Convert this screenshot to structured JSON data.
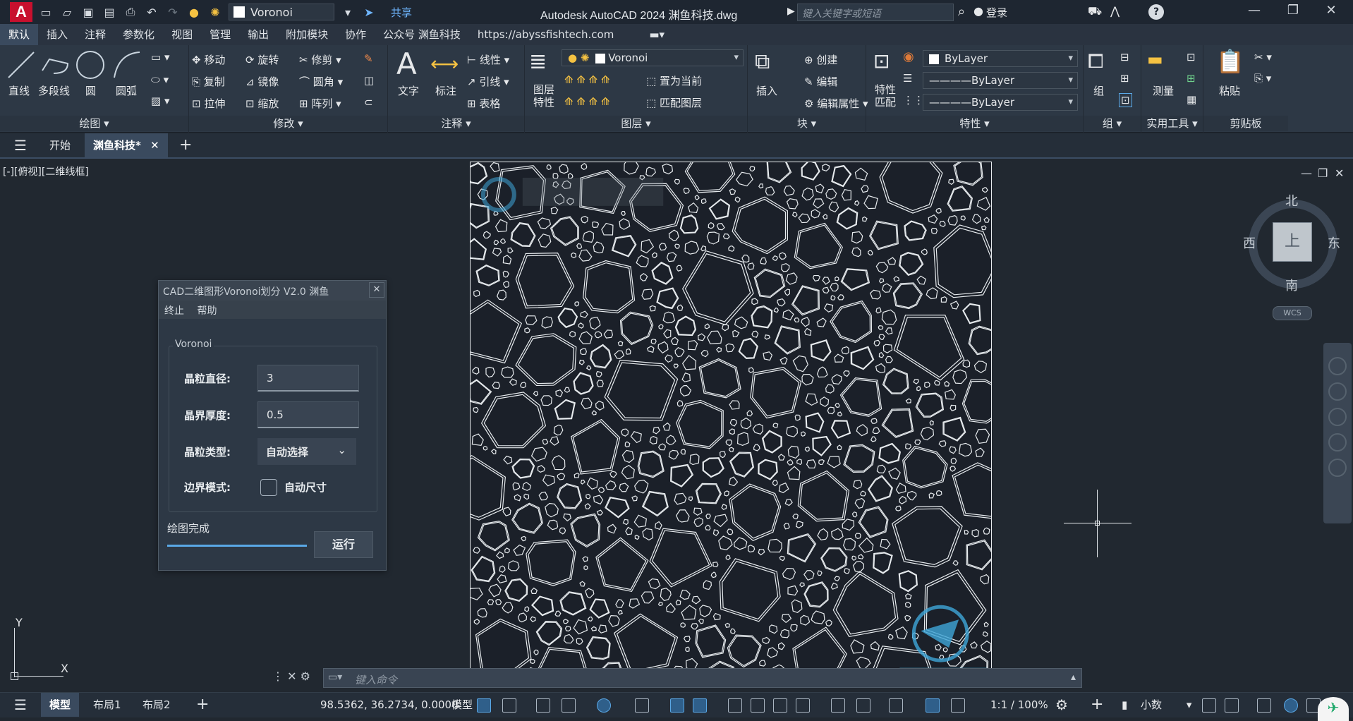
{
  "titlebar": {
    "logo": "A",
    "layer_combo": "Voronoi",
    "share": "共享",
    "title": "Autodesk AutoCAD 2024    渊鱼科技.dwg",
    "search_placeholder": "键入关键字或短语",
    "login": "登录"
  },
  "ribbon_tabs": [
    "默认",
    "插入",
    "注释",
    "参数化",
    "视图",
    "管理",
    "输出",
    "附加模块",
    "协作",
    "公众号 渊鱼科技",
    "https://abyssfishtech.com"
  ],
  "ribbon": {
    "draw": {
      "title": "绘图",
      "line": "直线",
      "polyline": "多段线",
      "circle": "圆",
      "arc": "圆弧"
    },
    "modify": {
      "title": "修改",
      "move": "移动",
      "rotate": "旋转",
      "trim": "修剪",
      "copy": "复制",
      "mirror": "镜像",
      "fillet": "圆角",
      "stretch": "拉伸",
      "scale": "缩放",
      "array": "阵列"
    },
    "annotation": {
      "title": "注释",
      "text": "文字",
      "dimension": "标注",
      "linear": "线性",
      "leader": "引线",
      "table": "表格"
    },
    "layers": {
      "title": "图层",
      "props": "图层\n特性",
      "current_layer": "Voronoi",
      "set_current": "置为当前",
      "match": "匹配图层"
    },
    "block": {
      "title": "块",
      "insert": "插入",
      "create": "创建",
      "edit": "编辑",
      "edit_attr": "编辑属性"
    },
    "properties": {
      "title": "特性",
      "match": "特性\n匹配",
      "color": "ByLayer",
      "linetype": "————ByLayer",
      "lineweight": "————ByLayer"
    },
    "groups": {
      "title": "组",
      "group": "组"
    },
    "utilities": {
      "title": "实用工具",
      "measure": "测量"
    },
    "clipboard": {
      "title": "剪贴板",
      "paste": "粘贴"
    }
  },
  "file_tabs": {
    "start": "开始",
    "active": "渊鱼科技*"
  },
  "viewport": {
    "label": "[-][俯视][二维线框]"
  },
  "dialog": {
    "title": "CAD二维图形Voronoi划分 V2.0 渊鱼",
    "menu": [
      "终止",
      "帮助"
    ],
    "group_label": "Voronoi",
    "grain_diameter_label": "晶粒直径:",
    "grain_diameter": "3",
    "boundary_thickness_label": "晶界厚度:",
    "boundary_thickness": "0.5",
    "grain_type_label": "晶粒类型:",
    "grain_type": "自动选择",
    "boundary_mode_label": "边界模式:",
    "auto_size": "自动尺寸",
    "status": "绘图完成",
    "progress": 1.0,
    "run": "运行"
  },
  "viewcube": {
    "north": "北",
    "south": "南",
    "east": "东",
    "west": "西",
    "top": "上",
    "wcs": "WCS"
  },
  "ucs": {
    "x": "X",
    "y": "Y"
  },
  "command": {
    "placeholder": "键入命令"
  },
  "statusbar": {
    "tabs": [
      "模型",
      "布局1",
      "布局2"
    ],
    "coords": "98.5362, 36.2734, 0.0000",
    "mode": "模型",
    "scale": "1:1 / 100%",
    "units": "小数"
  },
  "colors": {
    "accent": "#5aa8e6",
    "logo": "#c8102e",
    "background": "#212830"
  }
}
